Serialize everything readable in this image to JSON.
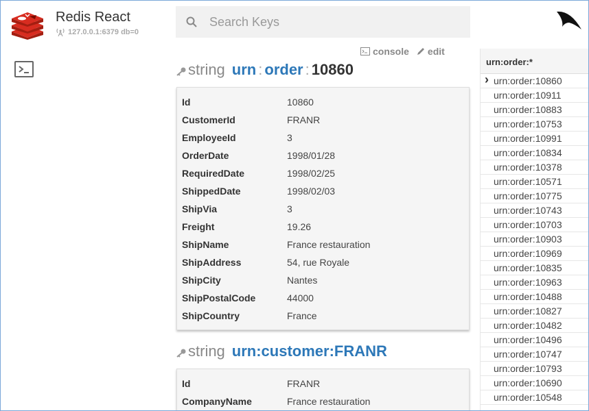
{
  "app": {
    "title": "Redis React",
    "connection": "127.0.0.1:6379 db=0"
  },
  "search": {
    "placeholder": "Search Keys"
  },
  "actions": {
    "console": "console",
    "edit": "edit"
  },
  "entries": [
    {
      "type": "string",
      "key_parts": [
        "urn",
        "order"
      ],
      "key_id": "10860",
      "fields": [
        {
          "k": "Id",
          "v": "10860"
        },
        {
          "k": "CustomerId",
          "v": "FRANR"
        },
        {
          "k": "EmployeeId",
          "v": "3"
        },
        {
          "k": "OrderDate",
          "v": "1998/01/28"
        },
        {
          "k": "RequiredDate",
          "v": "1998/02/25"
        },
        {
          "k": "ShippedDate",
          "v": "1998/02/03"
        },
        {
          "k": "ShipVia",
          "v": "3"
        },
        {
          "k": "Freight",
          "v": "19.26"
        },
        {
          "k": "ShipName",
          "v": "France restauration"
        },
        {
          "k": "ShipAddress",
          "v": "54, rue Royale"
        },
        {
          "k": "ShipCity",
          "v": "Nantes"
        },
        {
          "k": "ShipPostalCode",
          "v": "44000"
        },
        {
          "k": "ShipCountry",
          "v": "France"
        }
      ]
    },
    {
      "type": "string",
      "key": "urn:customer:FRANR",
      "fields": [
        {
          "k": "Id",
          "v": "FRANR"
        },
        {
          "k": "CompanyName",
          "v": "France restauration"
        }
      ]
    }
  ],
  "sidebar": {
    "pattern": "urn:order:*",
    "items": [
      "urn:order:10860",
      "urn:order:10911",
      "urn:order:10883",
      "urn:order:10753",
      "urn:order:10991",
      "urn:order:10834",
      "urn:order:10378",
      "urn:order:10571",
      "urn:order:10775",
      "urn:order:10743",
      "urn:order:10703",
      "urn:order:10903",
      "urn:order:10969",
      "urn:order:10835",
      "urn:order:10963",
      "urn:order:10488",
      "urn:order:10827",
      "urn:order:10482",
      "urn:order:10496",
      "urn:order:10747",
      "urn:order:10793",
      "urn:order:10690",
      "urn:order:10548"
    ],
    "selected": 0
  },
  "colors": {
    "key_blue": "#2d78b8",
    "redis_red": "#d82c20"
  },
  "icons": [
    "redis-logo-icon",
    "broadcast-icon",
    "terminal-icon",
    "search-icon",
    "brand-logo-icon",
    "key-icon",
    "pencil-icon"
  ]
}
